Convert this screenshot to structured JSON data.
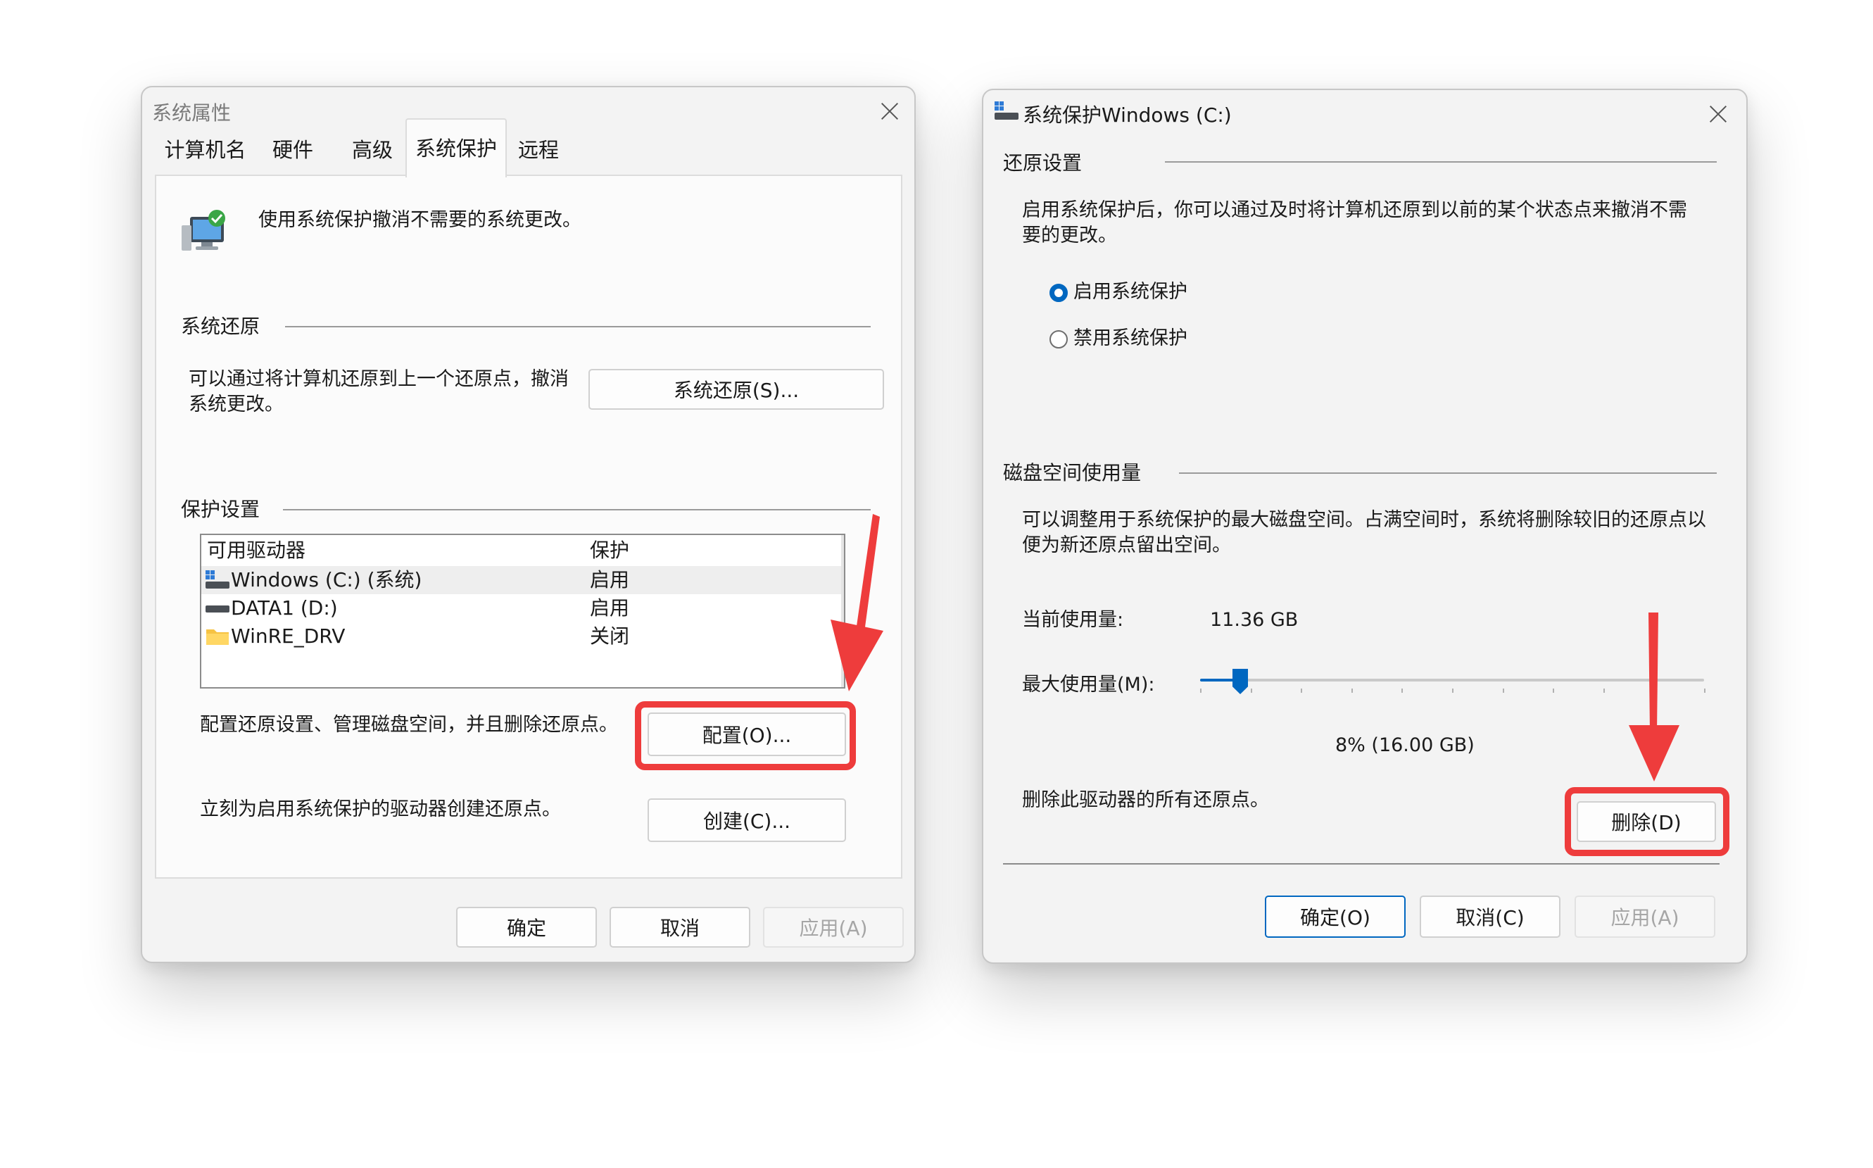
{
  "left_dialog": {
    "title": "系统属性",
    "tabs": [
      {
        "label": "计算机名",
        "active": false
      },
      {
        "label": "硬件",
        "active": false
      },
      {
        "label": "高级",
        "active": false
      },
      {
        "label": "系统保护",
        "active": true
      },
      {
        "label": "远程",
        "active": false
      }
    ],
    "intro_text": "使用系统保护撤消不需要的系统更改。",
    "system_restore": {
      "section_title": "系统还原",
      "description_line1": "可以通过将计算机还原到上一个还原点，撤消",
      "description_line2": "系统更改。",
      "button_label": "系统还原(S)..."
    },
    "protection": {
      "section_title": "保护设置",
      "columns": [
        "可用驱动器",
        "保护"
      ],
      "rows": [
        {
          "drive": "Windows (C:) (系统)",
          "protection": "启用",
          "icon": "system-drive-icon"
        },
        {
          "drive": "DATA1 (D:)",
          "protection": "启用",
          "icon": "drive-icon"
        },
        {
          "drive": "WinRE_DRV",
          "protection": "关闭",
          "icon": "folder-icon"
        }
      ],
      "configure_text": "配置还原设置、管理磁盘空间，并且删除还原点。",
      "configure_button": "配置(O)...",
      "create_text": "立刻为启用系统保护的驱动器创建还原点。",
      "create_button": "创建(C)..."
    },
    "buttons": {
      "ok": "确定",
      "cancel": "取消",
      "apply": "应用(A)"
    }
  },
  "right_dialog": {
    "title": "系统保护Windows (C:)",
    "restore_settings": {
      "section_title": "还原设置",
      "description_line1": "启用系统保护后，你可以通过及时将计算机还原到以前的某个状态点来撤消不需",
      "description_line2": "要的更改。",
      "options": [
        {
          "label": "启用系统保护",
          "selected": true
        },
        {
          "label": "禁用系统保护",
          "selected": false
        }
      ]
    },
    "disk_usage": {
      "section_title": "磁盘空间使用量",
      "description_line1": "可以调整用于系统保护的最大磁盘空间。占满空间时，系统将删除较旧的还原点以",
      "description_line2": "便为新还原点留出空间。",
      "current_label": "当前使用量:",
      "current_value": "11.36 GB",
      "max_label": "最大使用量(M):",
      "slider_percent": 8,
      "slider_value_text": "8% (16.00 GB)",
      "delete_text": "删除此驱动器的所有还原点。",
      "delete_button": "删除(D)"
    },
    "buttons": {
      "ok": "确定(O)",
      "cancel": "取消(C)",
      "apply": "应用(A)"
    }
  },
  "colors": {
    "annotation_red": "#ee3c3c",
    "accent_blue": "#0067c0"
  }
}
